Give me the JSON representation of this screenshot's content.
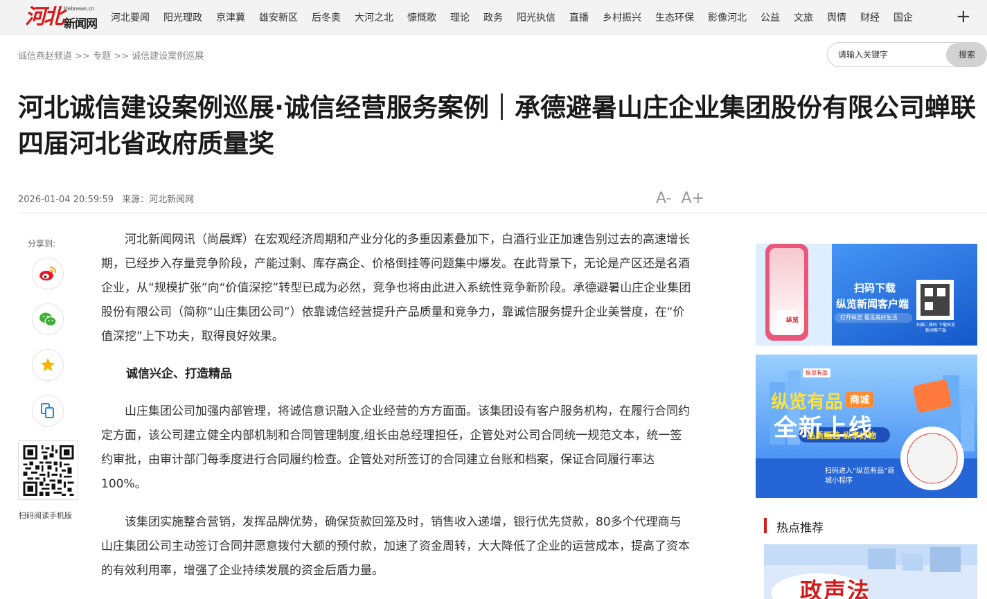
{
  "header": {
    "logo_domain": "Hebnews.cn",
    "logo_name": "新闻网",
    "logo_mark": "河北",
    "nav": [
      "河北要闻",
      "阳光理政",
      "京津冀",
      "雄安新区",
      "后冬奥",
      "大河之北",
      "慷慨歌",
      "理论",
      "政务",
      "阳光执信",
      "直播",
      "乡村振兴",
      "生态环保",
      "影像河北",
      "公益",
      "文旅",
      "舆情",
      "财经",
      "国企"
    ],
    "more": "+"
  },
  "breadcrumb": {
    "items": [
      "诚信燕赵频道",
      "专题",
      "诚信建设案例巡展"
    ],
    "separator": ">>"
  },
  "search": {
    "placeholder": "请输入关键字",
    "button": "搜索"
  },
  "article": {
    "title": "河北诚信建设案例巡展·诚信经营服务案例｜承德避暑山庄企业集团股份有限公司蝉联四届河北省政府质量奖",
    "date": "2026-01-04 20:59:59",
    "source": "来源：河北新闻网",
    "font_minus": "A-",
    "font_plus": "A+",
    "paragraphs": [
      "河北新闻网讯（尚晨辉）在宏观经济周期和产业分化的多重因素叠加下，白酒行业正加速告别过去的高速增长期，已经步入存量竞争阶段，产能过剩、库存高企、价格倒挂等问题集中爆发。在此背景下，无论是产区还是名酒企业，从“规模扩张”向“价值深挖”转型已成为必然，竞争也将由此进入系统性竞争新阶段。承德避暑山庄企业集团股份有限公司（简称“山庄集团公司”）依靠诚信经营提升产品质量和竞争力，靠诚信服务提升企业美誉度，在“价值深挖”上下功夫，取得良好效果。",
      "山庄集团公司加强内部管理，将诚信意识融入企业经营的方方面面。该集团设有客户服务机构，在履行合同约定方面，该公司建立健全内部机制和合同管理制度,组长由总经理担任，企管处对公司合同统一规范文本，统一签约审批，由审计部门每季度进行合同履约检查。企管处对所签订的合同建立台账和档案，保证合同履行率达100%。",
      "该集团实施整合营销，发挥品牌优势，确保货款回笼及时，销售收入递增，银行优先贷款，80多个代理商与山庄集团公司主动签订合同并愿意拨付大额的预付款，加速了资金周转，大大降低了企业的运营成本，提高了资本的有效利用率，增强了企业持续发展的资金后盾力量。"
    ],
    "subheading": "诚信兴企、打造精品"
  },
  "share": {
    "label": "分享到:",
    "buttons": [
      "weibo-icon",
      "wechat-icon",
      "favorite-icon",
      "copy-icon"
    ],
    "qr_caption": "扫码阅读手机版"
  },
  "sidebar": {
    "ad1": {
      "line1": "扫码下载",
      "line2": "纵览新闻客户端",
      "line3": "打开纵览  看见美好生活",
      "phone_text": "纵览",
      "qr_caption": "扫描二维码 下载纵览新闻客户端"
    },
    "ad2": {
      "brand": "纵览有品",
      "tag": "商城",
      "headline": "全新上线",
      "slogan": "品质甄选  纵享好物",
      "cta": "扫码进入“纵览有品”商城小程序"
    },
    "hot_title": "热点推荐",
    "hot_image_text": "政声法"
  },
  "colors": {
    "brand_red": "#d71a1a",
    "nav_bg": "#f3f3f3",
    "ad_blue": "#1e6fe0"
  }
}
